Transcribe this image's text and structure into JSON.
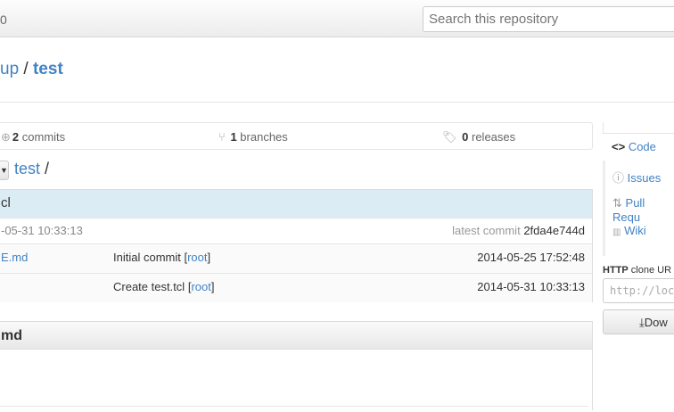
{
  "header": {
    "left_text": "0",
    "search_placeholder": "Search this repository"
  },
  "repo": {
    "owner": "up",
    "separator": "/",
    "name": "test"
  },
  "stats": {
    "commits_count": "2",
    "commits_label": "commits",
    "branches_count": "1",
    "branches_label": "branches",
    "releases_count": "0",
    "releases_label": "releases"
  },
  "breadcrumb": {
    "repo": "test",
    "separator": "/"
  },
  "commit_bar": {
    "message": "cl",
    "date": "-05-31 10:33:13",
    "latest_label": "latest commit",
    "sha": "2fda4e744d"
  },
  "files": [
    {
      "name": "E.md",
      "message": "Initial commit",
      "author": "root",
      "date": "2014-05-25 17:52:48"
    },
    {
      "name": "",
      "message": "Create test.tcl",
      "author": "root",
      "date": "2014-05-31 10:33:13"
    }
  ],
  "readme": {
    "title": "md"
  },
  "sidebar": {
    "items": [
      {
        "label": "Code"
      },
      {
        "label": "Issues"
      },
      {
        "label": "Pull Requ"
      },
      {
        "label": "Wiki"
      }
    ],
    "clone_label_bold": "HTTP",
    "clone_label": "clone UR",
    "clone_url": "http://local",
    "download_label": "Dow"
  }
}
